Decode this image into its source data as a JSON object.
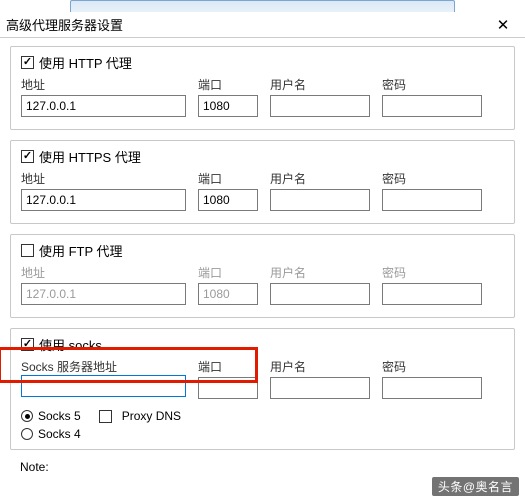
{
  "window": {
    "title": "高级代理服务器设置"
  },
  "labels": {
    "address": "地址",
    "port": "端口",
    "username": "用户名",
    "password": "密码",
    "socks_server": "Socks 服务器地址"
  },
  "http": {
    "use_label": "使用 HTTP 代理",
    "checked": true,
    "address": "127.0.0.1",
    "port": "1080",
    "user": "",
    "pass": ""
  },
  "https": {
    "use_label": "使用 HTTPS 代理",
    "checked": true,
    "address": "127.0.0.1",
    "port": "1080",
    "user": "",
    "pass": ""
  },
  "ftp": {
    "use_label": "使用 FTP 代理",
    "checked": false,
    "address": "127.0.0.1",
    "port": "1080",
    "user": "",
    "pass": ""
  },
  "socks": {
    "use_label": "使用 socks",
    "checked": true,
    "address": "",
    "port": "",
    "user": "",
    "pass": "",
    "socks5_label": "Socks 5",
    "socks4_label": "Socks 4",
    "proxydns_label": "Proxy DNS",
    "version": "5",
    "proxydns": false
  },
  "note": "Note:",
  "watermark": "头条@奥名言"
}
